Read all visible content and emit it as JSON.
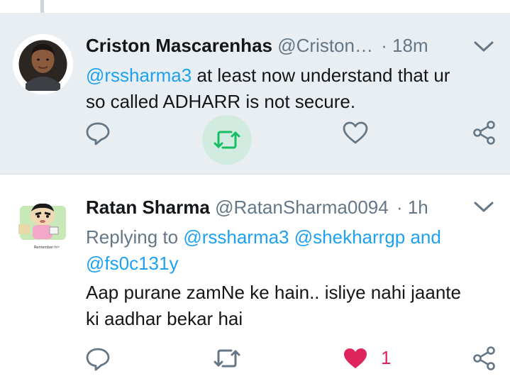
{
  "tweets": [
    {
      "name": "Criston Mascarenhas",
      "handle": "@Criston…",
      "time": "· 18m",
      "mention": "@rssharma3",
      "text_line1": " at least now understand that ur",
      "text_line2": "so called ADHARR is not secure.",
      "avatar_icon": "person-photo",
      "retweet_active": true,
      "retweet_color": "#17bf63",
      "action_color": "#657786"
    },
    {
      "name": "Ratan Sharma",
      "handle": "@RatanSharma0094",
      "time": "· 1h",
      "reply_prefix": "Replying to ",
      "reply_mentions": [
        "@rssharma3",
        "@shekharrgp",
        "@fs0c131y"
      ],
      "reply_and": " and",
      "text_line1": "Aap purane zamNe ke hain.. isliye nahi jaante",
      "text_line2": "ki aadhar bekar hai",
      "like_count": "1",
      "liked": true,
      "like_color": "#e0245e",
      "avatar_icon": "cartoon-character",
      "avatar_caption": "Remember his"
    }
  ]
}
